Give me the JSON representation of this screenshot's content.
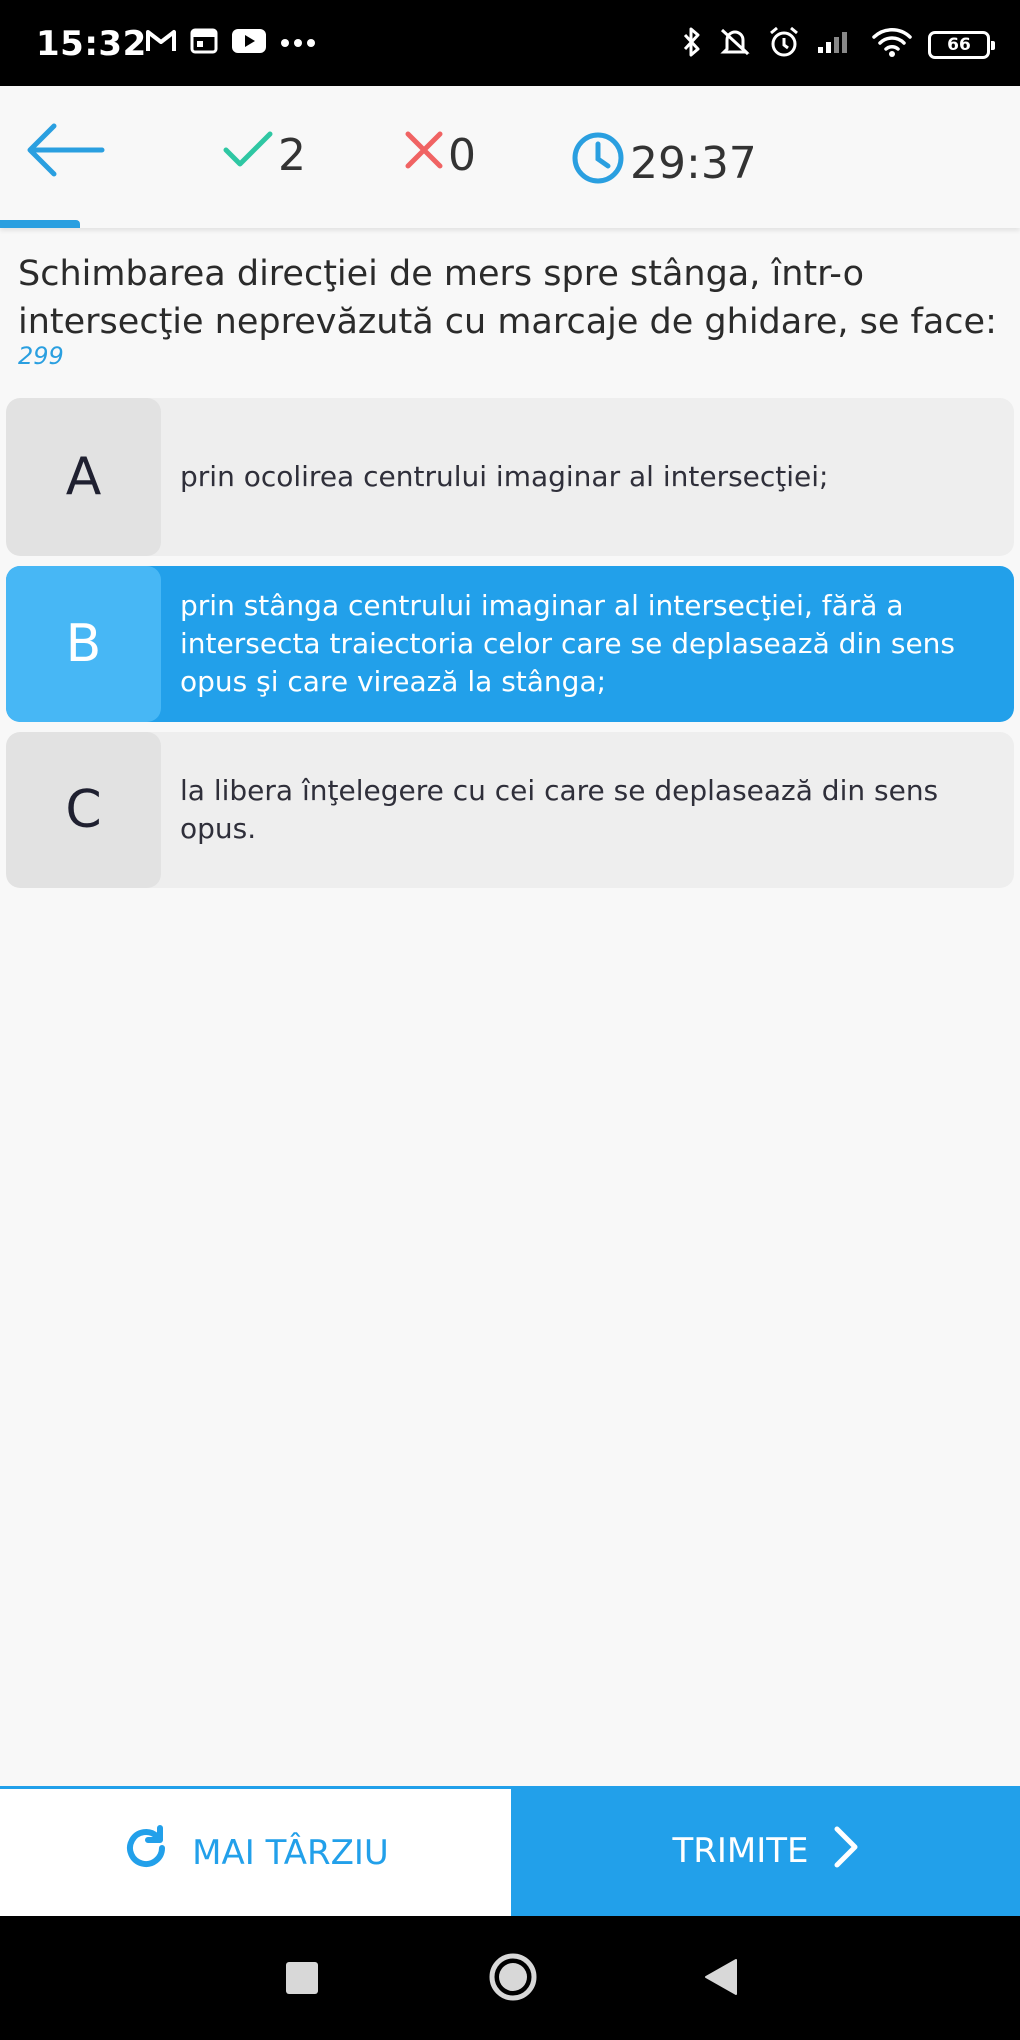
{
  "status_bar": {
    "time": "15:32",
    "battery": "66"
  },
  "header": {
    "correct_count": "2",
    "wrong_count": "0",
    "timer": "29:37",
    "colors": {
      "accent": "#2a9fe0",
      "correct": "#2fc7a3",
      "wrong": "#f06363"
    }
  },
  "question": {
    "text": "Schimbarea direcţiei de mers spre stânga, într-o intersecţie neprevăzută cu marcaje de ghidare, se face:",
    "id": "299"
  },
  "answers": [
    {
      "letter": "A",
      "text": "prin ocolirea centrului imaginar al intersecţiei;",
      "selected": false
    },
    {
      "letter": "B",
      "text": "prin stânga centrului imaginar al intersecţiei, fără a intersecta traiectoria celor care se deplasează din sens opus şi care virează la stânga;",
      "selected": true
    },
    {
      "letter": "C",
      "text": "la libera înţelegere cu cei care se deplasează din sens opus.",
      "selected": false
    }
  ],
  "footer": {
    "later_label": "MAI TÂRZIU",
    "submit_label": "TRIMITE"
  }
}
